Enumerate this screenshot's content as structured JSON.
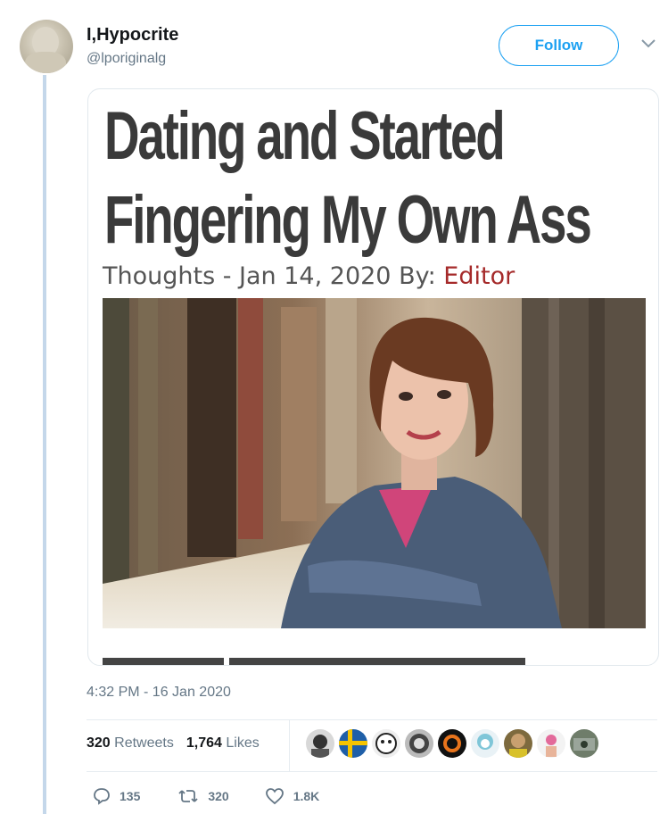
{
  "tweet": {
    "display_name": "I,Hypocrite",
    "handle": "@lporiginalg",
    "follow_label": "Follow",
    "timestamp": "4:32 PM - 16 Jan 2020"
  },
  "article_card": {
    "headline_line1": "Dating and Started",
    "headline_line2": "Fingering My Own Ass",
    "byline_prefix": "Thoughts - Jan 14, 2020 By: ",
    "byline_author": "Editor"
  },
  "stats": {
    "retweets_count": "320",
    "retweets_label": "Retweets",
    "likes_count": "1,764",
    "likes_label": "Likes"
  },
  "actions": {
    "replies": "135",
    "retweets": "320",
    "likes": "1.8K"
  },
  "colors": {
    "brand_blue": "#1da1f2",
    "muted_text": "#657786",
    "author_link": "#a52a2a",
    "headline_text": "#3a3a3a"
  },
  "icons": {
    "chevron": "chevron-down-icon",
    "reply": "reply-icon",
    "retweet": "retweet-icon",
    "like": "heart-icon"
  }
}
